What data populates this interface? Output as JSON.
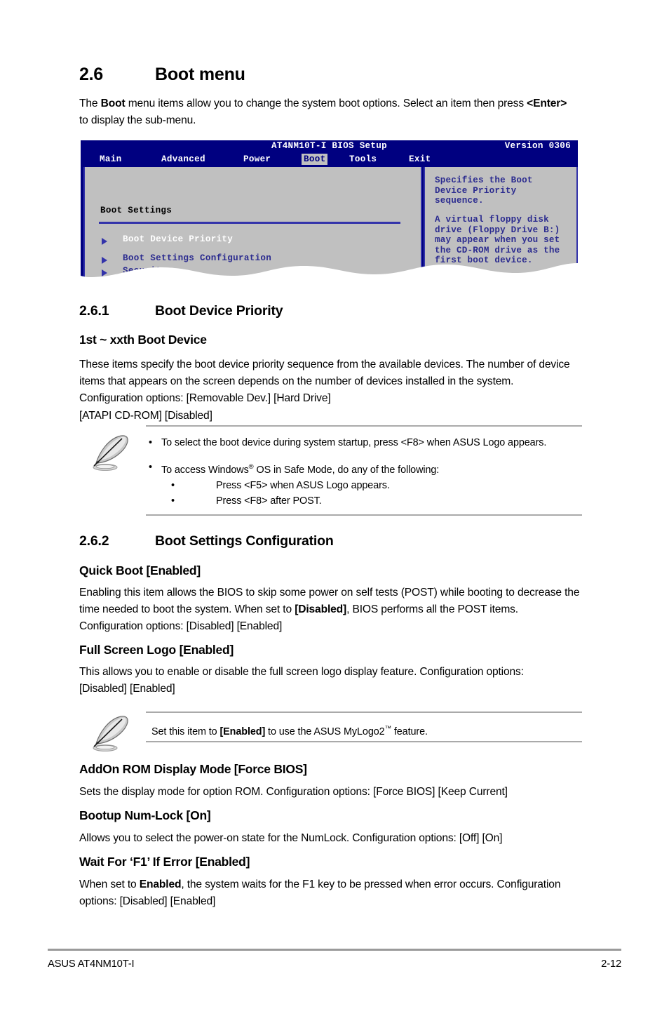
{
  "section": {
    "number": "2.6",
    "title": "Boot menu",
    "intro_pre": "The ",
    "intro_b1": "Boot",
    "intro_mid": " menu items allow you to change the system boot options. Select an item then press ",
    "intro_b2": "<Enter>",
    "intro_post": " to display the sub-menu."
  },
  "bios": {
    "title": "AT4NM10T-I BIOS Setup",
    "version": "Version 0306",
    "menu": [
      {
        "label": "Main",
        "active": false
      },
      {
        "label": "Advanced",
        "active": false
      },
      {
        "label": "Power",
        "active": false
      },
      {
        "label": "Boot",
        "active": true
      },
      {
        "label": "Tools",
        "active": false
      },
      {
        "label": "Exit",
        "active": false
      }
    ],
    "panel_title": "Boot Settings",
    "items": [
      {
        "label": "Boot Device Priority",
        "selected": true
      },
      {
        "label": "Boot Settings Configuration",
        "selected": false
      },
      {
        "label": "Security",
        "selected": false
      }
    ],
    "help_p1": "Specifies the Boot\nDevice Priority\nsequence.",
    "help_p2": "A virtual floppy disk\ndrive (Floppy Drive B:)\nmay appear when you set\nthe CD-ROM drive as the\nfirst boot device.",
    "colors": {
      "header_bg": "#000080",
      "panel_bg": "#c0c0c0",
      "text_blue": "#2b2b8f",
      "rule_blue": "#3333aa",
      "selected_text": "#ffffff"
    }
  },
  "sub_261": {
    "number": "2.6.1",
    "title": "Boot Device Priority",
    "heading": "1st ~ xxth Boot Device",
    "body_l1": "These items specify the boot device priority sequence from the available devices. The",
    "body_l2": "number of device items that appears on the screen depends on the number of devices",
    "body_l3": "installed in the system. Configuration options: [Removable Dev.] [Hard Drive]",
    "body_l4": "[ATAPI CD-ROM] [Disabled]"
  },
  "note1": {
    "icon": "quill-pen-icon",
    "bullet1": "To select the boot device during system startup, press <F8> when ASUS Logo appears.",
    "bullet2_pre": "To access Windows",
    "bullet2_post": " OS in Safe Mode, do any of the following:",
    "sub1": "Press <F5> when ASUS Logo appears.",
    "sub2": "Press <F8> after POST.",
    "bullet_glyph": "•"
  },
  "sub_262": {
    "number": "2.6.2",
    "title": "Boot Settings Configuration"
  },
  "items": [
    {
      "heading": "Quick Boot [Enabled]",
      "lines": [
        {
          "pre": "Enabling this item allows the BIOS to skip some power on self tests (POST) while booting to",
          "bold": "",
          "post": ""
        },
        {
          "pre": "decrease the time needed to boot the system. When set to ",
          "bold": "[Disabled]",
          "post": ", BIOS performs all the"
        },
        {
          "pre": "POST items. Configuration options: [Disabled] [Enabled]",
          "bold": "",
          "post": ""
        }
      ]
    },
    {
      "heading": "Full Screen Logo [Enabled]",
      "lines": [
        {
          "pre": "This allows you to enable or disable the full screen logo display feature. Configuration",
          "bold": "",
          "post": ""
        },
        {
          "pre": "options: [Disabled] [Enabled]",
          "bold": "",
          "post": ""
        }
      ]
    },
    {
      "heading": "AddOn ROM Display Mode [Force BIOS]",
      "lines": [
        {
          "pre": "Sets the display mode for option ROM. Configuration options: [Force BIOS] [Keep Current]",
          "bold": "",
          "post": ""
        }
      ]
    },
    {
      "heading": "Bootup Num-Lock [On]",
      "lines": [
        {
          "pre": "Allows you to select the power-on state for the NumLock. Configuration options: [Off] [On]",
          "bold": "",
          "post": ""
        }
      ]
    },
    {
      "heading": "Wait For ‘F1’ If Error [Enabled]",
      "lines": [
        {
          "pre": "When set to ",
          "bold": "Enabled",
          "post": ", the system waits for the F1 key to be pressed when error occurs."
        },
        {
          "pre": "Configuration options: [Disabled] [Enabled]",
          "bold": "",
          "post": ""
        }
      ]
    }
  ],
  "note2": {
    "icon": "quill-pen-icon",
    "pre": "Set this item to ",
    "bold": "[Enabled]",
    "mid": " to use the ASUS MyLogo2",
    "post": " feature."
  },
  "footer": {
    "left": "ASUS AT4NM10T-I",
    "right": "2-12"
  }
}
